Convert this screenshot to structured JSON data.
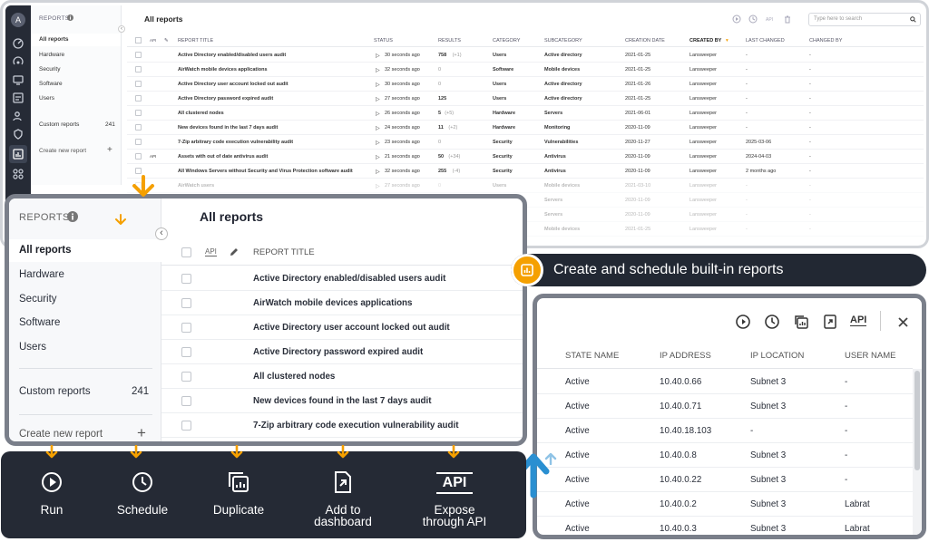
{
  "background_screenshot": {
    "avatar_letter": "A",
    "sidebar": {
      "heading": "REPORTS",
      "items": [
        "All reports",
        "Hardware",
        "Security",
        "Software",
        "Users"
      ],
      "custom_reports": {
        "label": "Custom reports",
        "count": "241"
      },
      "create_new": "Create new report"
    },
    "title": "All reports",
    "search_placeholder": "Type here to search",
    "columns": {
      "report_title": "REPORT TITLE",
      "status": "STATUS",
      "results": "RESULTS",
      "category": "CATEGORY",
      "subcategory": "SUBCATEGORY",
      "creation_date": "CREATION DATE",
      "created_by": "CREATED BY",
      "last_changed": "LAST CHANGED",
      "changed_by": "CHANGED BY"
    },
    "rows": [
      {
        "title": "Active Directory enabled/disabled users audit",
        "status": "30 seconds ago",
        "results": "758",
        "delta": "(+1)",
        "category": "Users",
        "subcategory": "Active directory",
        "created": "2021-01-25",
        "by": "Lansweeper",
        "last_changed": "-",
        "changed_by": "-"
      },
      {
        "title": "AirWatch mobile devices applications",
        "status": "32 seconds ago",
        "results": "0",
        "delta": "",
        "category": "Software",
        "subcategory": "Mobile devices",
        "created": "2021-01-25",
        "by": "Lansweeper",
        "last_changed": "-",
        "changed_by": "-"
      },
      {
        "title": "Active Directory user account locked out audit",
        "status": "30 seconds ago",
        "results": "0",
        "delta": "",
        "category": "Users",
        "subcategory": "Active directory",
        "created": "2021-01-26",
        "by": "Lansweeper",
        "last_changed": "-",
        "changed_by": "-"
      },
      {
        "title": "Active Directory password expired audit",
        "status": "27 seconds ago",
        "results": "125",
        "delta": "",
        "category": "Users",
        "subcategory": "Active directory",
        "created": "2021-01-25",
        "by": "Lansweeper",
        "last_changed": "-",
        "changed_by": "-"
      },
      {
        "title": "All clustered nodes",
        "status": "26 seconds ago",
        "results": "5",
        "delta": "(+5)",
        "category": "Hardware",
        "subcategory": "Servers",
        "created": "2021-06-01",
        "by": "Lansweeper",
        "last_changed": "-",
        "changed_by": "-"
      },
      {
        "title": "New devices found in the last 7 days audit",
        "status": "24 seconds ago",
        "results": "11",
        "delta": "(+2)",
        "category": "Hardware",
        "subcategory": "Monitoring",
        "created": "2020-11-09",
        "by": "Lansweeper",
        "last_changed": "-",
        "changed_by": "-"
      },
      {
        "title": "7-Zip arbitrary code execution vulnerability audit",
        "status": "23 seconds ago",
        "results": "0",
        "delta": "",
        "category": "Security",
        "subcategory": "Vulnerabilities",
        "created": "2020-11-27",
        "by": "Lansweeper",
        "last_changed": "2025-03-06",
        "changed_by": "-"
      },
      {
        "title": "Assets with out of date antivirus audit",
        "status": "21 seconds ago",
        "results": "50",
        "delta": "(+34)",
        "category": "Security",
        "subcategory": "Antivirus",
        "created": "2020-11-09",
        "by": "Lansweeper",
        "last_changed": "2024-04-03",
        "changed_by": "-"
      },
      {
        "title": "All Windows Servers without Security and Virus Protection software audit",
        "status": "32 seconds ago",
        "results": "255",
        "delta": "(-4)",
        "category": "Security",
        "subcategory": "Antivirus",
        "created": "2020-11-09",
        "by": "Lansweeper",
        "last_changed": "2 months ago",
        "changed_by": "-"
      },
      {
        "title": "AirWatch users",
        "status": "27 seconds ago",
        "results": "0",
        "delta": "",
        "category": "Users",
        "subcategory": "Mobile devices",
        "created": "2021-03-10",
        "by": "Lansweeper",
        "last_changed": "-",
        "changed_by": "-"
      },
      {
        "title": "",
        "status": "",
        "results": "",
        "delta": "",
        "category": "",
        "subcategory": "Servers",
        "created": "2020-11-09",
        "by": "Lansweeper",
        "last_changed": "-",
        "changed_by": "-"
      },
      {
        "title": "",
        "status": "",
        "results": "",
        "delta": "",
        "category": "",
        "subcategory": "Servers",
        "created": "2020-11-09",
        "by": "Lansweeper",
        "last_changed": "-",
        "changed_by": "-"
      },
      {
        "title": "",
        "status": "",
        "results": "",
        "delta": "",
        "category": "",
        "subcategory": "Mobile devices",
        "created": "2021-01-25",
        "by": "Lansweeper",
        "last_changed": "-",
        "changed_by": "-"
      }
    ]
  },
  "zoom_panel": {
    "heading": "REPORTS",
    "items": [
      "All reports",
      "Hardware",
      "Security",
      "Software",
      "Users"
    ],
    "custom_reports": {
      "label": "Custom reports",
      "count": "241"
    },
    "create_new": "Create new report",
    "title": "All reports",
    "api_label": "API",
    "column_report_title": "REPORT TITLE",
    "rows": [
      "Active Directory enabled/disabled users audit",
      "AirWatch mobile devices applications",
      "Active Directory user account locked out audit",
      "Active Directory password expired audit",
      "All clustered nodes",
      "New devices found in the last 7 days audit",
      "7-Zip arbitrary code execution vulnerability audit"
    ]
  },
  "banner": {
    "text": "Create and schedule built-in reports"
  },
  "popup": {
    "api_label": "API",
    "columns": {
      "state": "STATE NAME",
      "ip": "IP ADDRESS",
      "location": "IP LOCATION",
      "user": "USER NAME"
    },
    "rows": [
      {
        "state": "Active",
        "ip": "10.40.0.66",
        "location": "Subnet 3",
        "user": "-"
      },
      {
        "state": "Active",
        "ip": "10.40.0.71",
        "location": "Subnet 3",
        "user": "-"
      },
      {
        "state": "Active",
        "ip": "10.40.18.103",
        "location": "-",
        "user": "-"
      },
      {
        "state": "Active",
        "ip": "10.40.0.8",
        "location": "Subnet 3",
        "user": "-"
      },
      {
        "state": "Active",
        "ip": "10.40.0.22",
        "location": "Subnet 3",
        "user": "-"
      },
      {
        "state": "Active",
        "ip": "10.40.0.2",
        "location": "Subnet 3",
        "user": "Labrat"
      },
      {
        "state": "Active",
        "ip": "10.40.0.3",
        "location": "Subnet 3",
        "user": "Labrat"
      }
    ]
  },
  "actions": {
    "run": "Run",
    "schedule": "Schedule",
    "duplicate": "Duplicate",
    "dashboard_1": "Add to",
    "dashboard_2": "dashboard",
    "api_1": "Expose",
    "api_2": "through API",
    "api_icon_text": "API"
  },
  "colors": {
    "accent": "#f5a000",
    "dark": "#252a35",
    "blue_arrow": "#4aa3d9",
    "frame": "#7a7f8a"
  },
  "icons": [
    "run-icon",
    "schedule-icon",
    "duplicate-icon",
    "add-to-dashboard-icon",
    "api-icon",
    "info-icon",
    "plus-icon",
    "pencil-icon",
    "close-icon",
    "search-icon",
    "report-chart-icon"
  ]
}
